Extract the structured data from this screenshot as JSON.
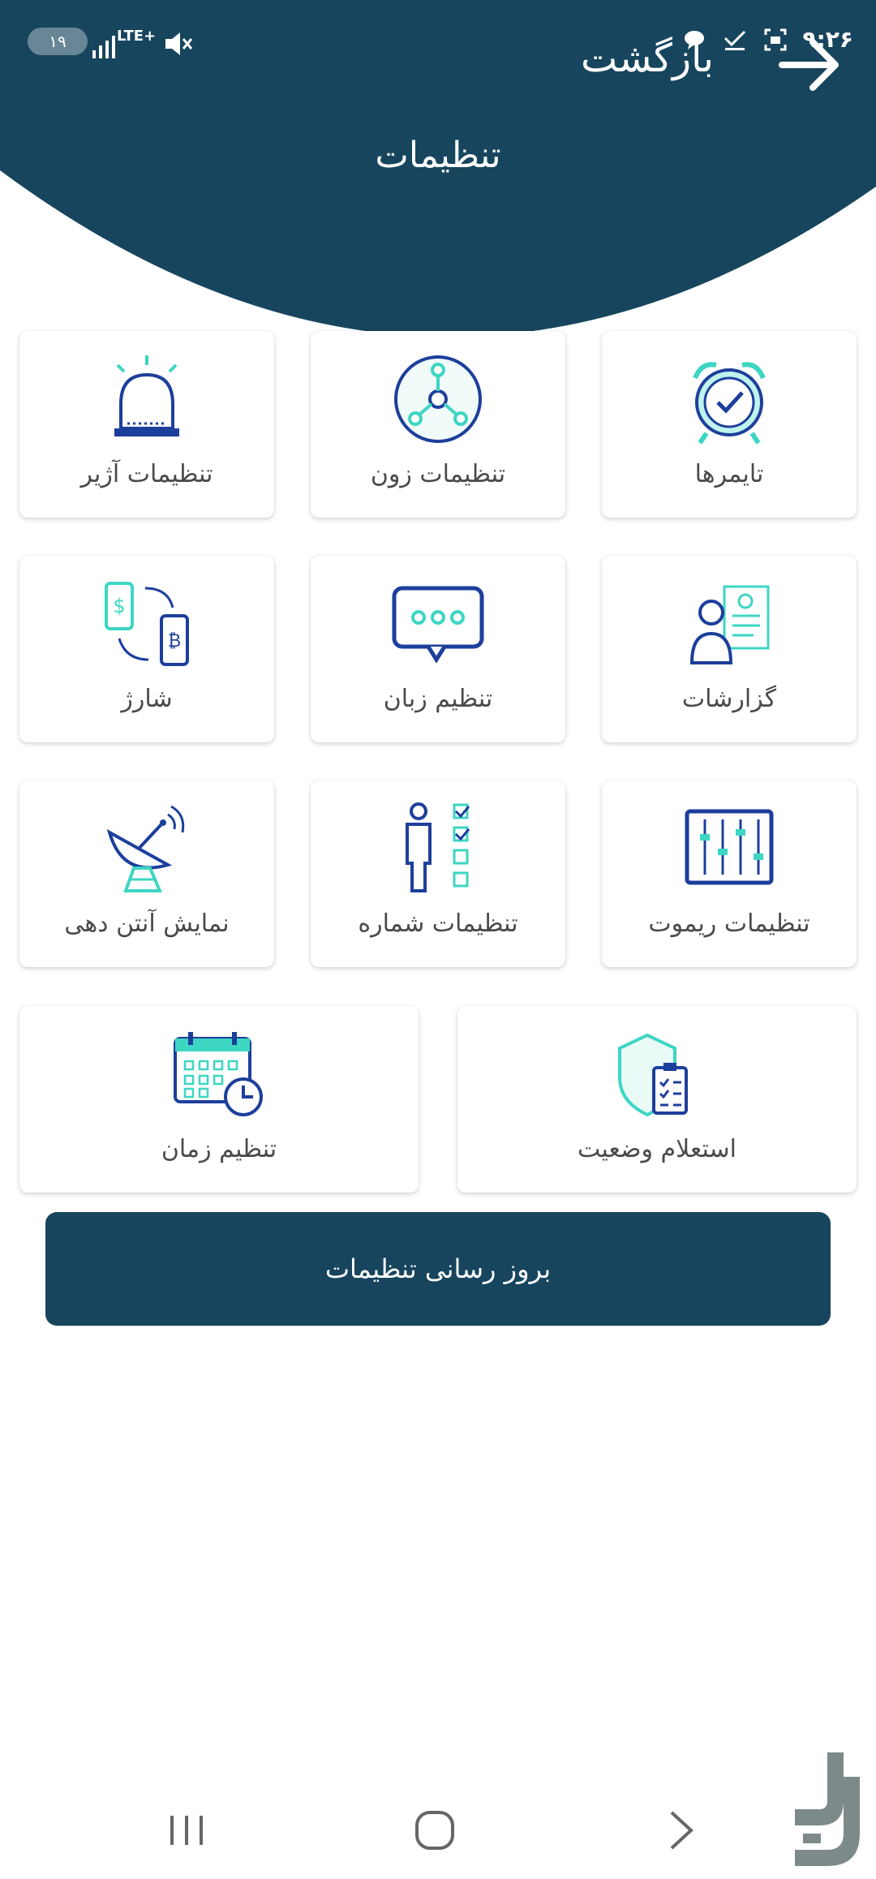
{
  "status_bar": {
    "battery": "۱۹",
    "network": "LTE+",
    "time": "۹:۲۶"
  },
  "header": {
    "back_label": "بازگشت",
    "title": "تنظیمات",
    "bg_color": "#17455e"
  },
  "grid": {
    "row1": [
      {
        "label": "تایمرها",
        "icon": "alarm-clock-icon"
      },
      {
        "label": "تنظیمات زون",
        "icon": "zone-network-icon"
      },
      {
        "label": "تنظیمات آژیر",
        "icon": "siren-icon"
      }
    ],
    "row2": [
      {
        "label": "گزارشات",
        "icon": "report-icon"
      },
      {
        "label": "تنظیم زبان",
        "icon": "chat-bubble-icon"
      },
      {
        "label": "شارژ",
        "icon": "charge-exchange-icon"
      }
    ],
    "row3": [
      {
        "label": "تنظیمات ریموت",
        "icon": "remote-sliders-icon"
      },
      {
        "label": "تنظیمات شماره",
        "icon": "person-checklist-icon"
      },
      {
        "label": "نمایش آنتن دهی",
        "icon": "satellite-dish-icon"
      }
    ],
    "row4": [
      {
        "label": "استعلام وضعیت",
        "icon": "shield-clipboard-icon"
      },
      {
        "label": "تنظیم زمان",
        "icon": "calendar-clock-icon"
      }
    ]
  },
  "update_button": {
    "label": "بروز رسانی تنظیمات"
  },
  "colors": {
    "primary": "#17455e",
    "icon_blue": "#1d3f9c",
    "icon_teal": "#3dd6c3"
  }
}
